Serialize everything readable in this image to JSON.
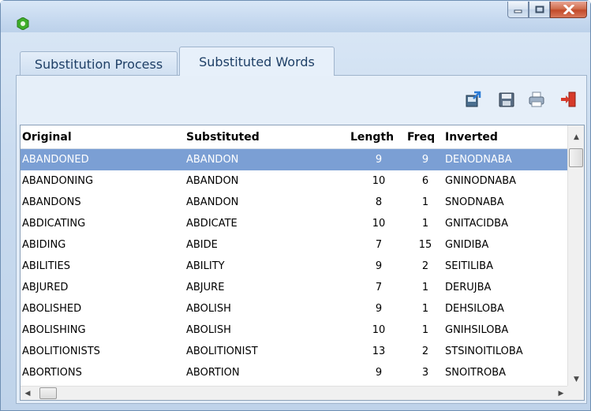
{
  "window": {
    "title": "",
    "controls": [
      "minimize-icon",
      "maximize-icon",
      "close-icon"
    ]
  },
  "tabs": [
    {
      "label": "Substitution Process",
      "active": false
    },
    {
      "label": "Substituted Words",
      "active": true
    }
  ],
  "toolbar": {
    "icons": [
      "import-icon",
      "save-icon",
      "print-icon",
      "exit-icon"
    ]
  },
  "grid": {
    "columns": [
      "Original",
      "Substituted",
      "Length",
      "Freq",
      "Inverted"
    ],
    "rows": [
      {
        "original": "ABANDONED",
        "substituted": "ABANDON",
        "length": "9",
        "freq": "9",
        "inverted": "DENODNABA",
        "selected": true
      },
      {
        "original": "ABANDONING",
        "substituted": "ABANDON",
        "length": "10",
        "freq": "6",
        "inverted": "GNINODNABA"
      },
      {
        "original": "ABANDONS",
        "substituted": "ABANDON",
        "length": "8",
        "freq": "1",
        "inverted": "SNODNABA"
      },
      {
        "original": "ABDICATING",
        "substituted": "ABDICATE",
        "length": "10",
        "freq": "1",
        "inverted": "GNITACIDBA"
      },
      {
        "original": "ABIDING",
        "substituted": "ABIDE",
        "length": "7",
        "freq": "15",
        "inverted": "GNIDIBA"
      },
      {
        "original": "ABILITIES",
        "substituted": "ABILITY",
        "length": "9",
        "freq": "2",
        "inverted": "SEITILIBA"
      },
      {
        "original": "ABJURED",
        "substituted": "ABJURE",
        "length": "7",
        "freq": "1",
        "inverted": "DERUJBA"
      },
      {
        "original": "ABOLISHED",
        "substituted": "ABOLISH",
        "length": "9",
        "freq": "1",
        "inverted": "DEHSILOBA"
      },
      {
        "original": "ABOLISHING",
        "substituted": "ABOLISH",
        "length": "10",
        "freq": "1",
        "inverted": "GNIHSILOBA"
      },
      {
        "original": "ABOLITIONISTS",
        "substituted": "ABOLITIONIST",
        "length": "13",
        "freq": "2",
        "inverted": "STSINOITILOBA"
      },
      {
        "original": "ABORTIONS",
        "substituted": "ABORTION",
        "length": "9",
        "freq": "3",
        "inverted": "SNOITROBA"
      }
    ]
  },
  "colors": {
    "selection": "#7b9fd4",
    "tab_text": "#1e3f66",
    "chrome": "#c9dbef"
  }
}
